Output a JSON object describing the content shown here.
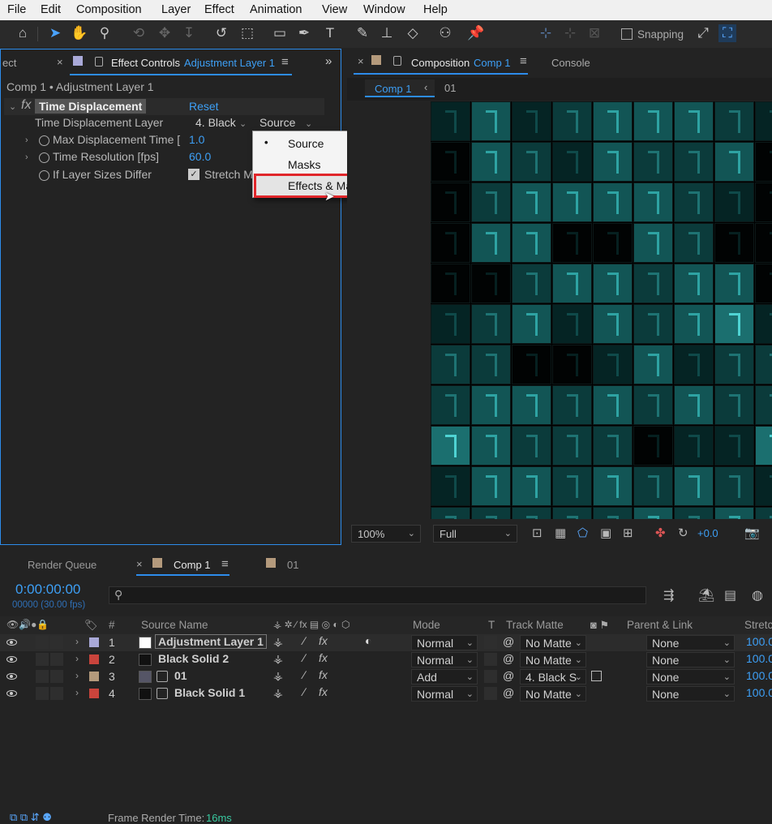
{
  "menu": [
    "File",
    "Edit",
    "Composition",
    "Layer",
    "Effect",
    "Animation",
    "View",
    "Window",
    "Help"
  ],
  "toolbar": {
    "snapping_label": "Snapping"
  },
  "effect_controls": {
    "left_tab_partial": "ect",
    "tab_label": "Effect Controls",
    "tab_layer": "Adjustment Layer 1",
    "breadcrumb": "Comp 1 • Adjustment Layer 1",
    "effect_name": "Time Displacement",
    "reset_label": "Reset",
    "params": [
      {
        "label": "Time Displacement Layer",
        "value": "4. Black",
        "value2": "Source"
      },
      {
        "label": "Max Displacement Time [",
        "value": "1.0"
      },
      {
        "label": "Time Resolution [fps]",
        "value": "60.0"
      },
      {
        "label": "If Layer Sizes Differ",
        "value": "Stretch M"
      }
    ]
  },
  "dropdown": {
    "items": [
      "Source",
      "Masks",
      "Effects & Masks"
    ],
    "selected_bullet": "•"
  },
  "composition": {
    "tab_label": "Composition",
    "tab_comp": "Comp 1",
    "console_tab": "Console",
    "nav_comp": "Comp 1",
    "nav_other": "01",
    "zoom": "100%",
    "resolution": "Full",
    "exposure": "+0.0"
  },
  "timeline": {
    "render_queue_tab": "Render Queue",
    "comp_tab": "Comp 1",
    "other_tab": "01",
    "timecode": "0:00:00:00",
    "frames": "00000 (30.00 fps)",
    "columns": {
      "num": "#",
      "source_name": "Source Name",
      "mode": "Mode",
      "t": "T",
      "track_matte": "Track Matte",
      "parent": "Parent & Link",
      "stretch": "Stretc"
    },
    "layers": [
      {
        "num": "1",
        "name": "Adjustment Layer 1",
        "mode": "Normal",
        "matte": "No Matte",
        "parent": "None",
        "stretch": "100.0",
        "label_color": "#a9a9d8"
      },
      {
        "num": "2",
        "name": "Black Solid 2",
        "mode": "Normal",
        "matte": "No Matte",
        "parent": "None",
        "stretch": "100.0",
        "label_color": "#c9443c"
      },
      {
        "num": "3",
        "name": "01",
        "mode": "Add",
        "matte": "4. Black S",
        "parent": "None",
        "stretch": "100.0",
        "label_color": "#b49a7c"
      },
      {
        "num": "4",
        "name": "Black Solid 1",
        "mode": "Normal",
        "matte": "No Matte",
        "parent": "None",
        "stretch": "100.0",
        "label_color": "#c9443c"
      }
    ],
    "footer_label": "Frame Render Time:",
    "footer_value": "16ms"
  },
  "colors": {
    "accent": "#2d8ceb",
    "highlight_box": "#e0262a",
    "teal": "#1fb8b8"
  }
}
